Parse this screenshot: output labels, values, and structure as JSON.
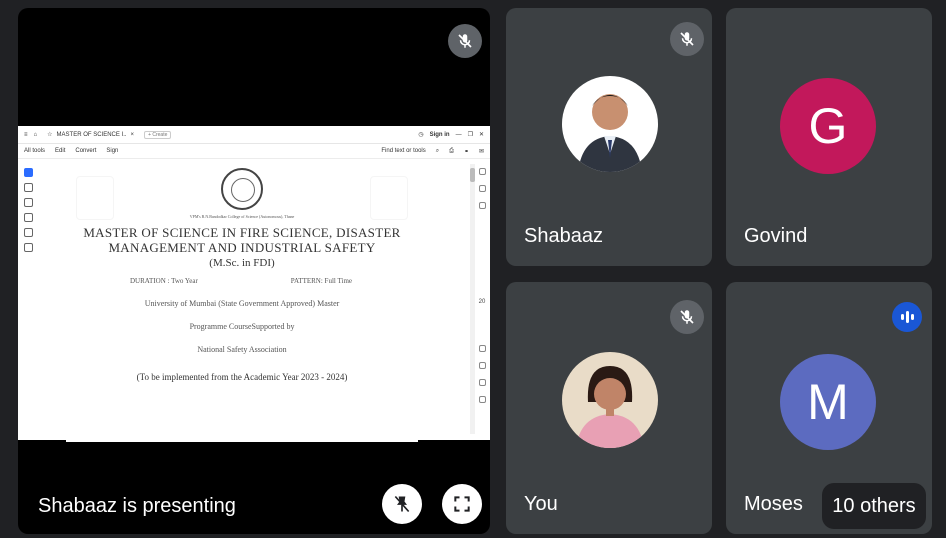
{
  "presenter": {
    "label": "Shabaaz is presenting"
  },
  "browser": {
    "tab_title": "MASTER OF SCIENCE I..",
    "tab_close": "×",
    "new_tab": "+ Create",
    "sign_in": "Sign in",
    "menu": [
      "All tools",
      "Edit",
      "Convert",
      "Sign"
    ],
    "find": "Find text or tools",
    "page_number": "20"
  },
  "document": {
    "institution": "VPM's B.N.Bandodkar College of Science (Autonomous), Thane",
    "title": "MASTER OF SCIENCE IN FIRE SCIENCE, DISASTER MANAGEMENT AND INDUSTRIAL SAFETY",
    "subtitle": "(M.Sc. in FDI)",
    "duration": "DURATION : Two Year",
    "pattern": "PATTERN: Full Time",
    "line1": "University of Mumbai (State Government Approved) Master",
    "line2": "Programme CourseSupported by",
    "line3": "National Safety Association",
    "line4": "(To be implemented from the Academic Year 2023 - 2024)"
  },
  "participants": [
    {
      "name": "Shabaaz",
      "muted": true
    },
    {
      "name": "Govind",
      "initial": "G",
      "color": "#c2185b"
    },
    {
      "name": "You",
      "muted": true
    },
    {
      "name": "Moses",
      "initial": "M",
      "color": "#5c6bc0",
      "speaking": true
    }
  ],
  "others": "10 others",
  "colors": {
    "background": "#202124",
    "tile": "#3c4043",
    "speaking": "#1a57d6"
  }
}
